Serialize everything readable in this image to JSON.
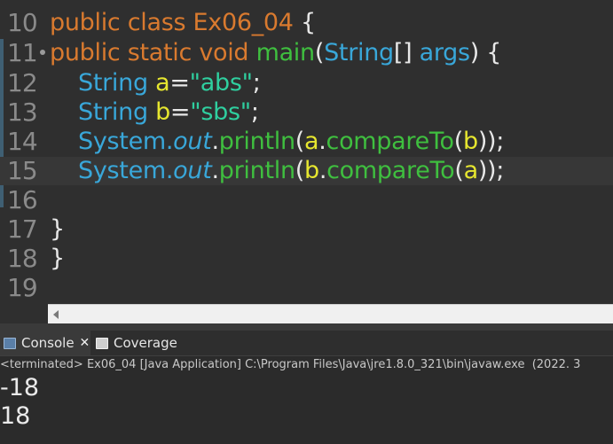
{
  "editor": {
    "lines": [
      {
        "no": "10"
      },
      {
        "no": "11"
      },
      {
        "no": "12"
      },
      {
        "no": "13"
      },
      {
        "no": "14"
      },
      {
        "no": "15"
      },
      {
        "no": "16"
      },
      {
        "no": "17"
      },
      {
        "no": "18"
      },
      {
        "no": "19"
      }
    ],
    "code": {
      "l10_kw": "public class ",
      "l10_name": "Ex06_04",
      "l10_rest": " {",
      "l11_kw": "public static void ",
      "l11_method": "main",
      "l11_p1": "(",
      "l11_type": "String",
      "l11_p2": "[] ",
      "l11_arg": "args",
      "l11_p3": ") {",
      "l12_type": "String ",
      "l12_var": "a",
      "l12_eq": "=",
      "l12_str": "\"abs\"",
      "l12_end": ";",
      "l13_type": "String ",
      "l13_var": "b",
      "l13_eq": "=",
      "l13_str": "\"sbs\"",
      "l13_end": ";",
      "l14_sys": "System.",
      "l14_out": "out",
      "l14_dot": ".",
      "l14_println": "println",
      "l14_p1": "(",
      "l14_a": "a",
      "l14_dot2": ".",
      "l14_cmp": "compareTo",
      "l14_p2": "(",
      "l14_b": "b",
      "l14_p3": "));",
      "l15_sys": "System.",
      "l15_out": "out",
      "l15_dot": ".",
      "l15_println": "println",
      "l15_p1": "(",
      "l15_b": "b",
      "l15_dot2": ".",
      "l15_cmp": "compareTo",
      "l15_p2": "(",
      "l15_a": "a",
      "l15_p3": "));",
      "l17": "}",
      "l18": "}"
    }
  },
  "console": {
    "tabs": [
      {
        "label": "Console"
      },
      {
        "label": "Coverage"
      }
    ],
    "status": "<terminated> Ex06_04 [Java Application] C:\\Program Files\\Java\\jre1.8.0_321\\bin\\javaw.exe  (2022. 3",
    "output": [
      "-18",
      "18"
    ]
  },
  "colors": {
    "keyword": "#d97a2f",
    "type": "#39a7d9",
    "method": "#3fbf3f",
    "string": "#2fcf9f",
    "variable": "#e6e62f",
    "background": "#2f2f2f"
  },
  "icons": [
    "fold-marker-icon",
    "console-icon",
    "close-icon",
    "coverage-icon",
    "scroll-left-arrow-icon"
  ]
}
